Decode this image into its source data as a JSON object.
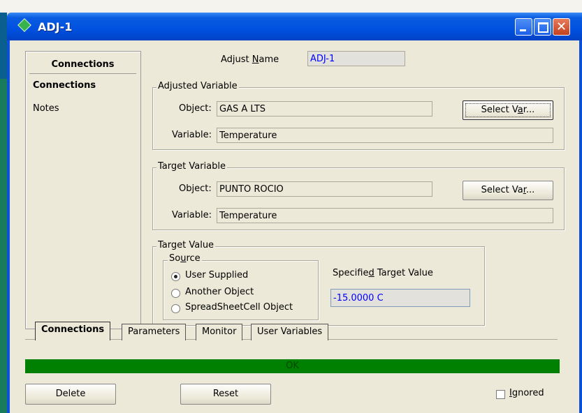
{
  "window": {
    "title": "ADJ-1"
  },
  "nav": {
    "header": "Connections",
    "items": [
      {
        "label": "Connections",
        "selected": true
      },
      {
        "label": "Notes",
        "selected": false
      }
    ]
  },
  "adjust_name": {
    "label_pre": "Adjust ",
    "label_u": "N",
    "label_post": "ame",
    "value": "ADJ-1"
  },
  "adjusted_variable": {
    "title": "Adjusted Variable",
    "object_label": "Object:",
    "object_value": "GAS A LTS",
    "variable_label": "Variable:",
    "variable_value": "Temperature",
    "button_pre": "Select V",
    "button_u": "a",
    "button_post": "r..."
  },
  "target_variable": {
    "title": "Target Variable",
    "object_label": "Object:",
    "object_value": "PUNTO ROCIO",
    "variable_label": "Variable:",
    "variable_value": "Temperature",
    "button_pre": "Select Va",
    "button_u": "r",
    "button_post": "..."
  },
  "target_value": {
    "title": "Target Value",
    "source_title": "Source",
    "options": [
      "User Supplied",
      "Another Object",
      "SpreadSheetCell Object"
    ],
    "selected": "User Supplied",
    "specified_label_pre": "Specifie",
    "specified_label_u": "d",
    "specified_label_post": " Target Value",
    "specified_value": "-15.0000 C"
  },
  "tabs": [
    {
      "label": "Connections",
      "active": true
    },
    {
      "label": "Parameters",
      "active": false
    },
    {
      "label": "Monitor",
      "active": false
    },
    {
      "label": "User Variables",
      "active": false
    }
  ],
  "status": {
    "text": "OK",
    "color": "#008000"
  },
  "footer": {
    "delete": "Delete",
    "reset": "Reset",
    "ignored_u": "I",
    "ignored_post": "gnored"
  },
  "colors": {
    "titlebar": "#0050e0",
    "status_ok": "#008000",
    "value_text": "#0000ff"
  }
}
